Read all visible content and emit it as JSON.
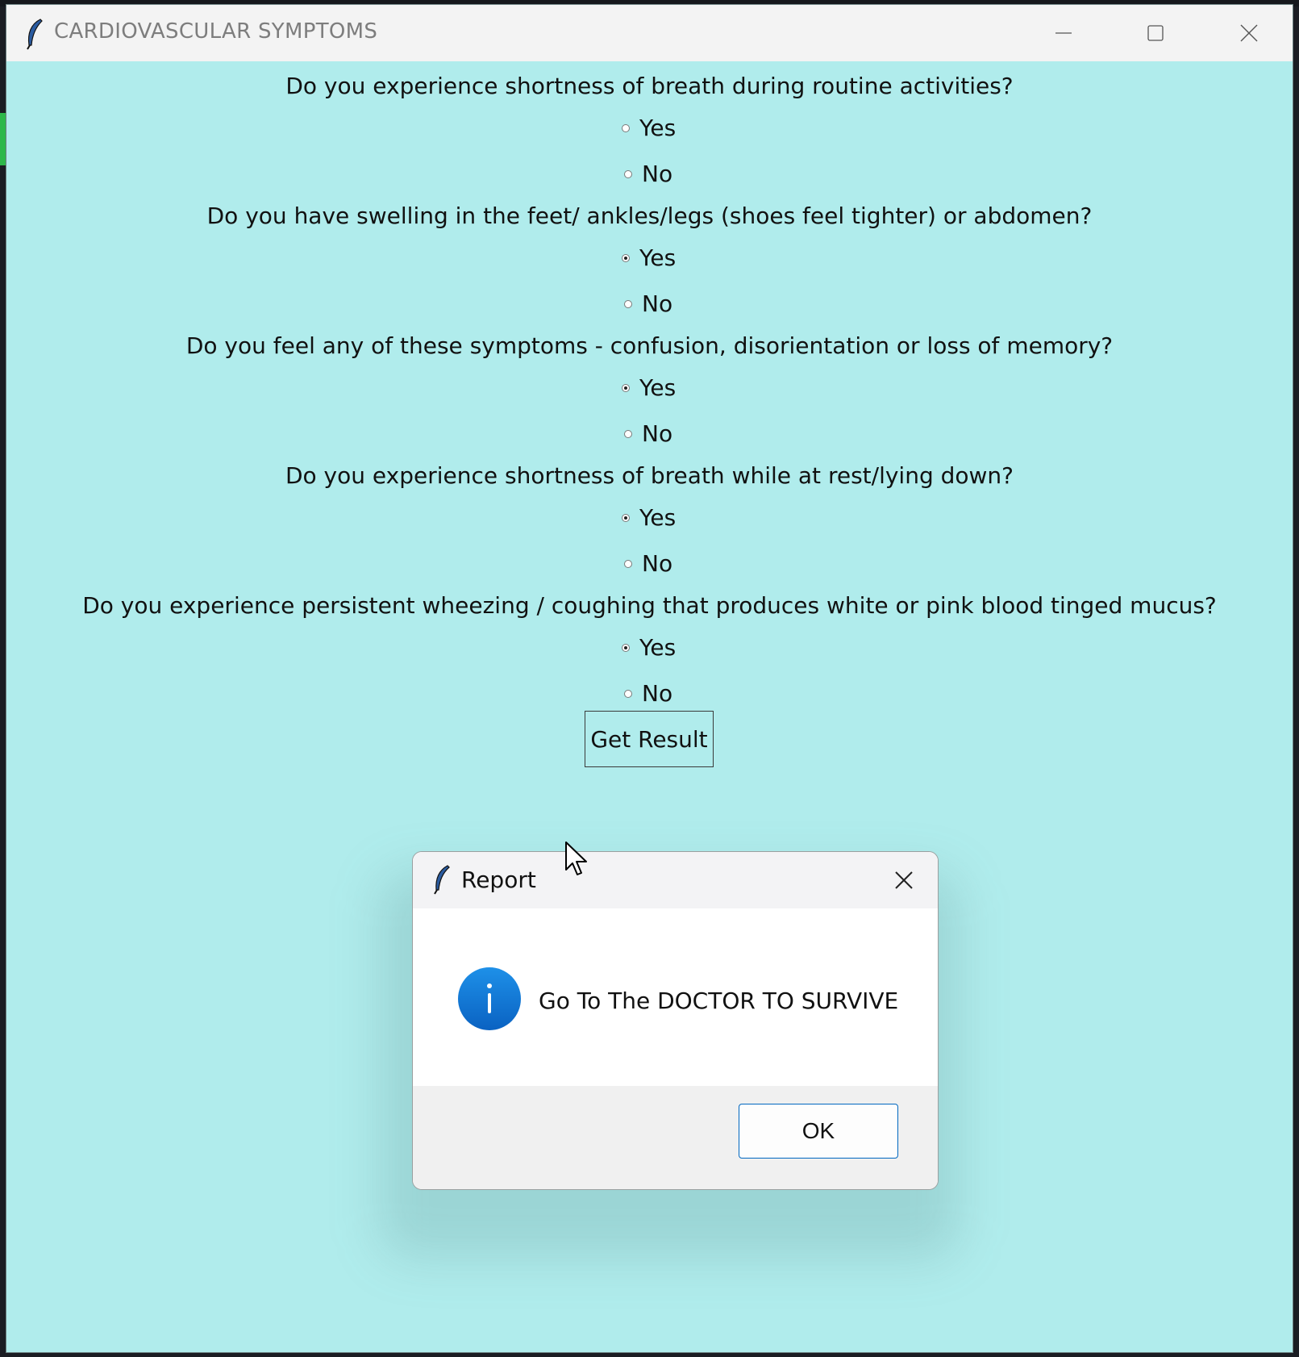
{
  "window": {
    "title": "CARDIOVASCULAR SYMPTOMS"
  },
  "questions": [
    {
      "text": "Do you experience shortness of breath during routine activities?",
      "yes_label": "Yes",
      "no_label": "No",
      "selected": "none"
    },
    {
      "text": "Do you have swelling in the feet/ ankles/legs (shoes feel tighter) or abdomen?",
      "yes_label": "Yes",
      "no_label": "No",
      "selected": "yes"
    },
    {
      "text": "Do you feel any of these symptoms - confusion, disorientation or loss of memory?",
      "yes_label": "Yes",
      "no_label": "No",
      "selected": "yes"
    },
    {
      "text": "Do you experience shortness of breath while at rest/lying down?",
      "yes_label": "Yes",
      "no_label": "No",
      "selected": "yes"
    },
    {
      "text": "Do you experience persistent wheezing / coughing that produces white or pink blood tinged mucus?",
      "yes_label": "Yes",
      "no_label": "No",
      "selected": "yes"
    }
  ],
  "get_result_label": "Get Result",
  "dialog": {
    "title": "Report",
    "message": "Go To The DOCTOR TO SURVIVE",
    "ok_label": "OK",
    "icon": "info-icon"
  },
  "colors": {
    "window_bg": "#b0ecec",
    "info_blue": "#0f78d4",
    "ok_border": "#0067c0"
  }
}
